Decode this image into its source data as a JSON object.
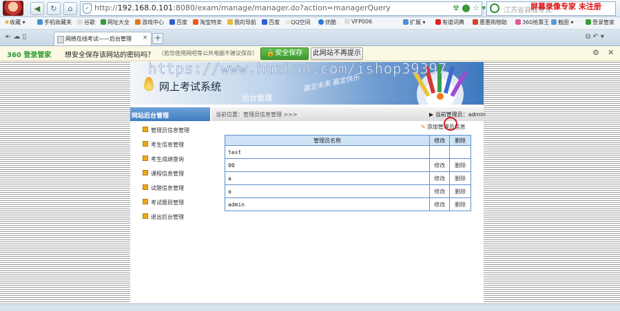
{
  "browser": {
    "url_prefix": "http://",
    "url_host": "192.168.0.101",
    "url_rest": ":8080/exam/manage/manager.do?action=managerQuery",
    "search_placeholder": "江苏省县城考试",
    "recorder_watermark": "屏幕录像专家  未注册"
  },
  "favorites": {
    "collect": "收藏",
    "items": [
      "手机收藏夹",
      "谷歌",
      "网址大全",
      "游戏中心",
      "百度",
      "淘宝特卖",
      "我的导航",
      "百度",
      "QQ空间",
      "优酷",
      "VFP006"
    ],
    "right_items": [
      "扩展",
      "有道词典",
      "惠惠购物助",
      "360抢票王",
      "截图",
      "登录管家"
    ]
  },
  "tab": {
    "title": "网络在线考试——后台管理",
    "close": "×",
    "new": "+"
  },
  "password_bar": {
    "logo": "360 登录管家",
    "message": "想安全保存该网站的密码吗？",
    "hint": "（若您使用网吧等公共电脑不建议保存）",
    "save_label": "安全保存",
    "never_label": "此网站不再提示"
  },
  "site": {
    "title": "网上考试系统",
    "subtitle": "后台管理",
    "slogan": "赢定未来 赢定快乐"
  },
  "watermark": "https://www.huzhan.com/ishop39397",
  "nav": {
    "header": "网站后台管理",
    "items": [
      "管理员信息管理",
      "考生信息管理",
      "考生成绩查询",
      "课程信息管理",
      "试题信息管理",
      "考试题目管理",
      "退出后台管理"
    ]
  },
  "main": {
    "breadcrumb": "当前位置：管理员信息管理 >>>",
    "current_admin": "当前管理员：admin",
    "add_link": "添加管理员信息",
    "table": {
      "headers": [
        "管理员名称",
        "修改",
        "删除"
      ],
      "rows": [
        {
          "name": "test",
          "edit": "",
          "delete": ""
        },
        {
          "name": "00",
          "edit": "修改",
          "delete": "删除"
        },
        {
          "name": "a",
          "edit": "修改",
          "delete": "删除"
        },
        {
          "name": "a",
          "edit": "修改",
          "delete": "删除"
        },
        {
          "name": "admin",
          "edit": "修改",
          "delete": "删除"
        }
      ]
    }
  },
  "colors": {
    "nav_header": "#3d7cc0",
    "table_border": "#5d8fcd",
    "table_header": "#cfe3f7",
    "save_button": "#3d9a2f"
  }
}
